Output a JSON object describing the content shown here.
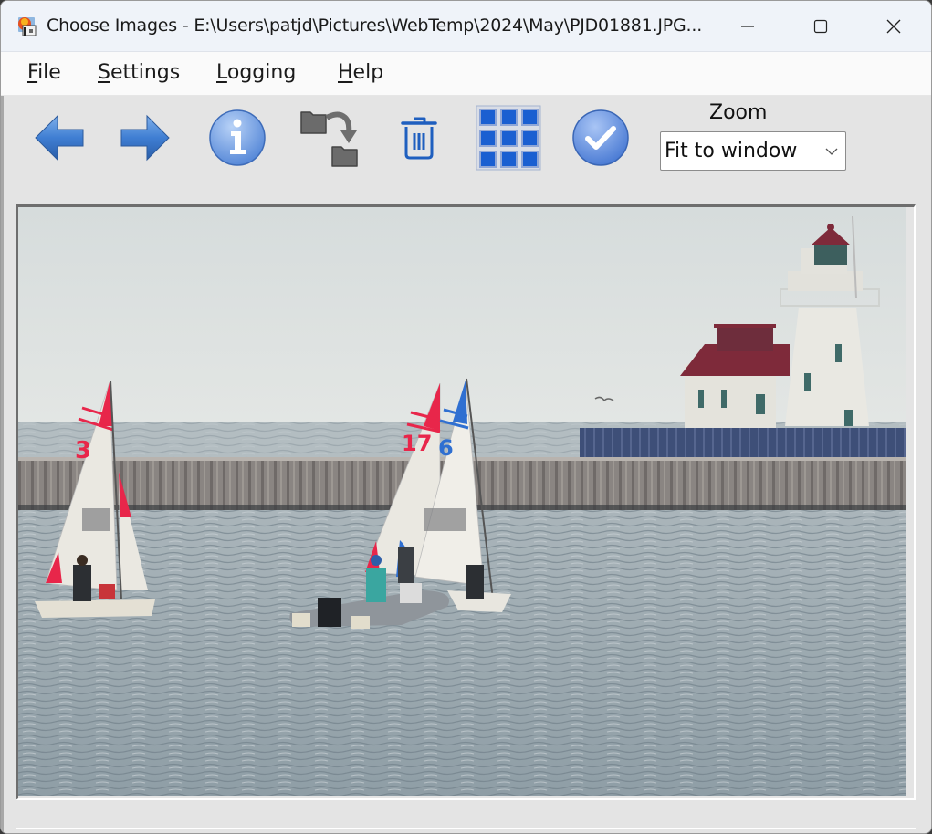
{
  "window": {
    "title": "Choose Images - E:\\Users\\patjd\\Pictures\\WebTemp\\2024\\May\\PJD01881.JPG...",
    "app_icon": "house-photo-icon",
    "controls": {
      "minimize": "minimize-icon",
      "maximize": "maximize-icon",
      "close": "close-icon"
    }
  },
  "menu": {
    "items": [
      {
        "label": "File",
        "mnemonic": "F",
        "rest": "ile"
      },
      {
        "label": "Settings",
        "mnemonic": "S",
        "rest": "ettings"
      },
      {
        "label": "Logging",
        "mnemonic": "L",
        "rest": "ogging"
      },
      {
        "label": "Help",
        "mnemonic": "H",
        "rest": "elp"
      }
    ]
  },
  "toolbar": {
    "buttons": [
      {
        "name": "previous-image",
        "icon": "arrow-left-icon"
      },
      {
        "name": "next-image",
        "icon": "arrow-right-icon"
      },
      {
        "name": "image-info",
        "icon": "info-icon"
      },
      {
        "name": "move-to-folder",
        "icon": "folder-move-icon"
      },
      {
        "name": "delete-image",
        "icon": "trash-icon"
      },
      {
        "name": "thumbnail-grid",
        "icon": "grid-icon"
      },
      {
        "name": "accept-selection",
        "icon": "checkmark-icon"
      }
    ],
    "zoom": {
      "label": "Zoom",
      "selected": "Fit to window"
    }
  },
  "image": {
    "filename": "PJD01881.JPG",
    "description": "Sailboats numbered 3, 17 and 6 with a coach boat in front of a harbor breakwall and lighthouse",
    "sail_numbers": [
      "3",
      "17",
      "6"
    ],
    "colors": {
      "sky": "#dde3e3",
      "water": "#9aa7ae",
      "wall": "#8a8582",
      "wall_blue": "#3e4f78",
      "roof": "#7e2a3a",
      "sail_red": "#e8264a",
      "sail_blue": "#2f6fd1"
    }
  }
}
